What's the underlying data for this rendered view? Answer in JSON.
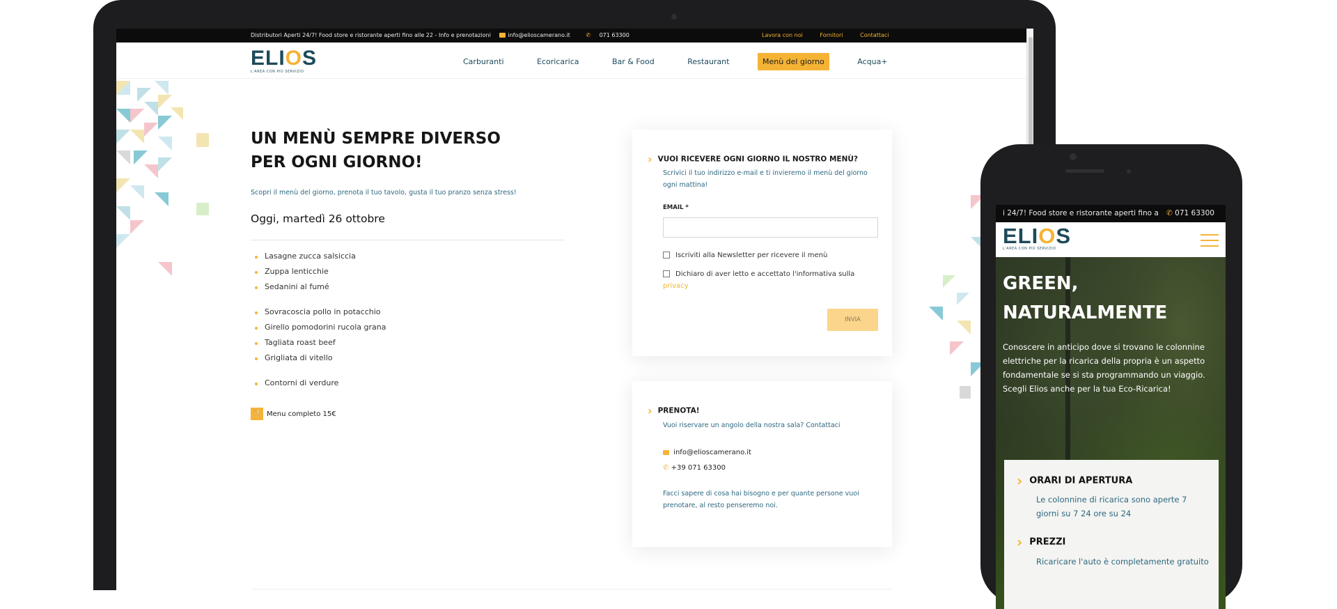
{
  "desktop": {
    "topbar": {
      "info": "Distributori Aperti 24/7! Food store e ristorante aperti fino alle 22 - Info e prenotazioni",
      "email": "info@elioscamerano.it",
      "phone": "071 63300",
      "links": [
        "Lavora con noi",
        "Fornitori",
        "Contattaci"
      ]
    },
    "logo": {
      "word_a": "ELI",
      "word_o": "O",
      "word_b": "S",
      "tagline": "L'AREA CON PIÙ SERVIZIO"
    },
    "nav": [
      {
        "label": "Carburanti",
        "active": false
      },
      {
        "label": "Ecoricarica",
        "active": false
      },
      {
        "label": "Bar & Food",
        "active": false
      },
      {
        "label": "Restaurant",
        "active": false
      },
      {
        "label": "Menù del giorno",
        "active": true
      },
      {
        "label": "Acqua+",
        "active": false
      }
    ],
    "hero": {
      "title_line1": "UN MENÙ SEMPRE DIVERSO",
      "title_line2": "PER OGNI GIORNO!",
      "subtitle": "Scopri il menù del giorno, prenota il tuo tavolo, gusta il tuo pranzo senza stress!"
    },
    "date": "Oggi, martedì 26 ottobre",
    "menu_groups": [
      [
        "Lasagne zucca salsiccia",
        "Zuppa lenticchie",
        "Sedanini al fumé"
      ],
      [
        "Sovracoscia pollo in potacchio",
        "Girello pomodorini rucola grana",
        "Tagliata roast beef",
        "Grigliata di vitello"
      ],
      [
        "Contorni di verdure"
      ]
    ],
    "price": "Menu completo 15€",
    "newsletter": {
      "title": "VUOI RICEVERE OGNI GIORNO IL NOSTRO MENÙ?",
      "text": "Scrivici il tuo indirizzo e-mail e ti invieremo il menù del giorno ogni mattina!",
      "email_label": "EMAIL *",
      "email_value": "",
      "check1": "Iscriviti alla Newsletter per ricevere il menù",
      "check2": "Dichiaro di aver letto e accettato l'informativa sulla",
      "check2_link": "privacy",
      "submit": "INVIA"
    },
    "booking": {
      "title": "PRENOTA!",
      "text": "Vuoi riservare un angolo della nostra sala? Contattaci",
      "email": "info@elioscamerano.it",
      "phone": "+39 071 63300",
      "note": "Facci sapere di cosa hai bisogno e per quante persone vuoi prenotare, al resto penseremo noi."
    }
  },
  "mobile": {
    "topbar_text": "i 24/7! Food store e ristorante aperti fino a",
    "topbar_phone": "071 63300",
    "logo": {
      "word_a": "ELI",
      "word_o": "O",
      "word_b": "S",
      "tagline": "L'AREA CON PIÙ SERVIZIO"
    },
    "hero_title_line1": "GREEN,",
    "hero_title_line2": "NATURALMENTE",
    "hero_text": "Conoscere in anticipo dove si trovano le colonnine elettriche per la ricarica della propria è un aspetto fondamentale se si sta programmando un viaggio. Scegli Elios anche per la tua Eco-Ricarica!",
    "card": [
      {
        "title": "ORARI DI APERTURA",
        "text": "Le colonnine di ricarica sono aperte 7 giorni su 7 24 ore su 24"
      },
      {
        "title": "PREZZI",
        "text": "Ricaricare l'auto è completamente gratuito"
      }
    ]
  },
  "colors": {
    "accent": "#f5b335",
    "brand": "#1d4a5b",
    "text_secondary": "#2e6880"
  }
}
